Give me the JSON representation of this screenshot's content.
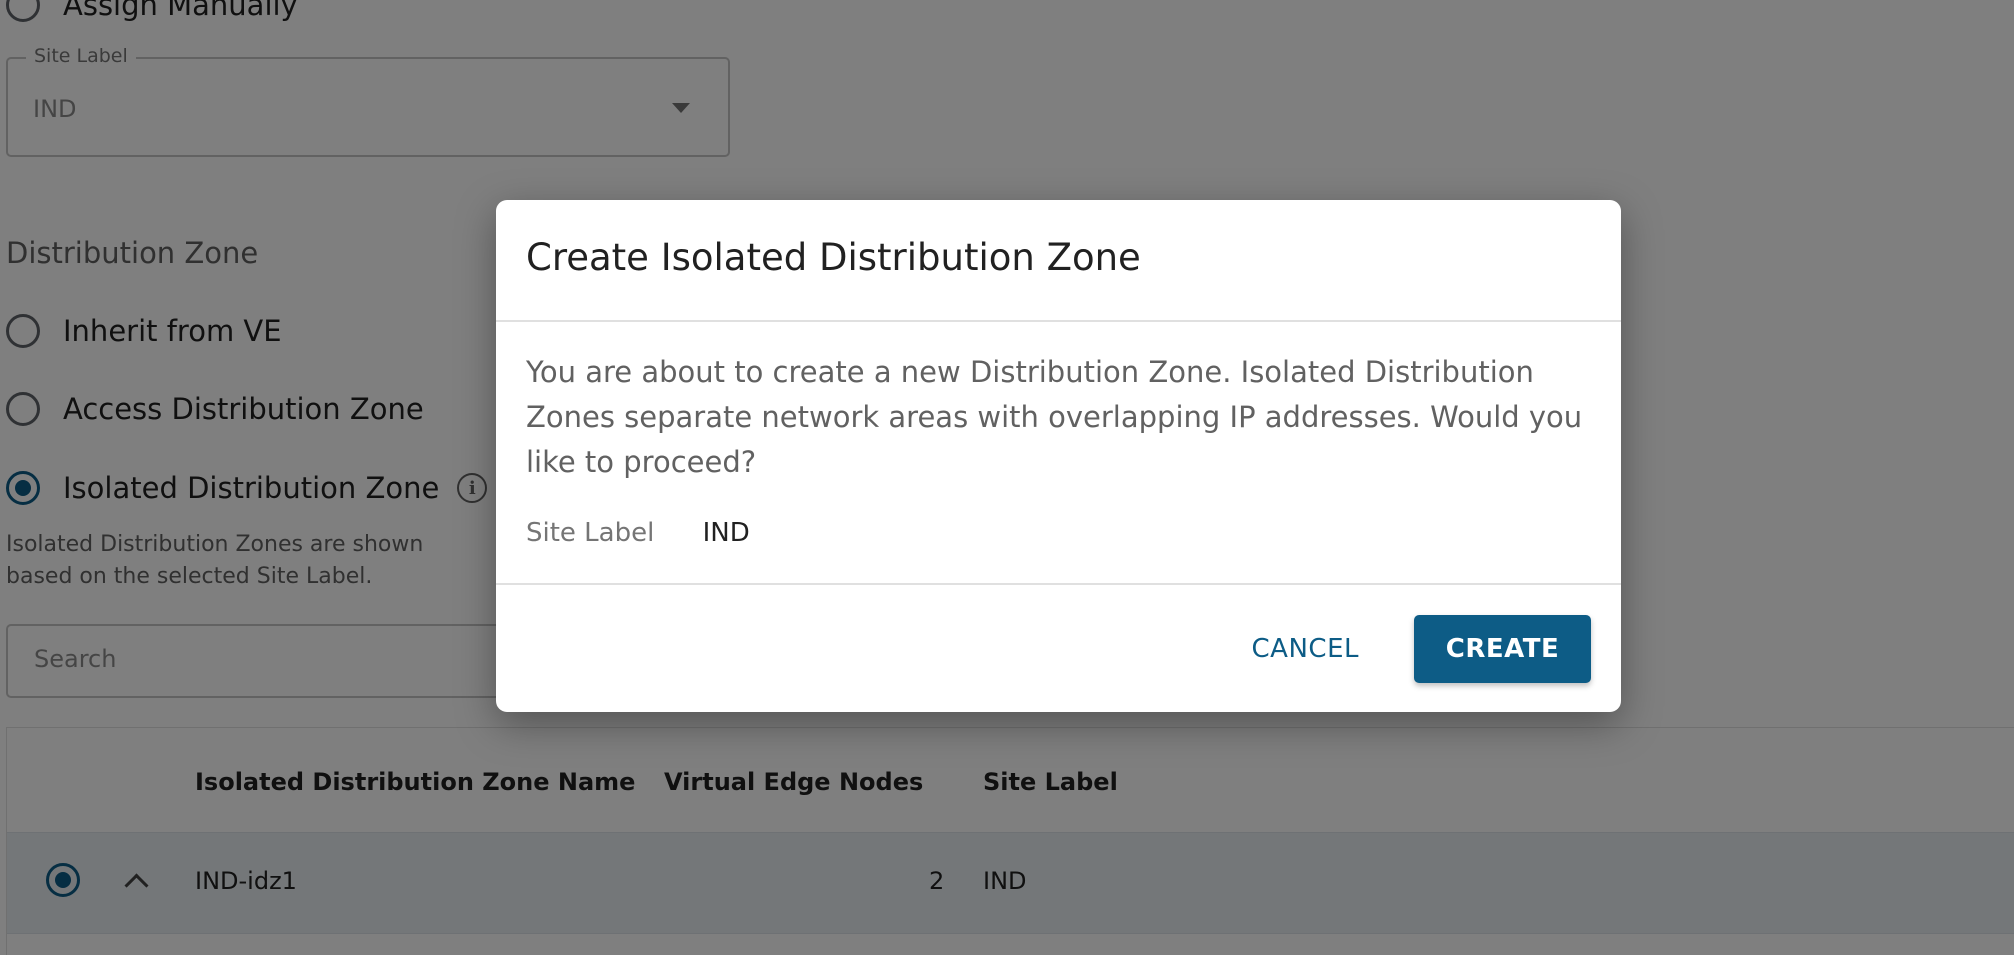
{
  "background": {
    "assign_manually_label": "Assign Manually",
    "site_label_field": {
      "label": "Site Label",
      "value": "IND"
    },
    "distribution_zone": {
      "heading": "Distribution Zone",
      "options": [
        {
          "label": "Inherit from VE",
          "selected": false
        },
        {
          "label": "Access Distribution Zone",
          "selected": false
        },
        {
          "label": "Isolated Distribution Zone",
          "selected": true
        }
      ],
      "helper_text": "Isolated Distribution Zones are shown based on the selected Site Label."
    },
    "search": {
      "placeholder": "Search"
    },
    "table": {
      "columns": [
        "Isolated Distribution Zone Name",
        "Virtual Edge Nodes",
        "Site Label"
      ],
      "rows": [
        {
          "name": "IND-idz1",
          "virtual_edge_nodes": "2",
          "site_label": "IND",
          "selected": true,
          "expanded": true
        }
      ]
    }
  },
  "dialog": {
    "title": "Create Isolated Distribution Zone",
    "message": "You are about to create a new Distribution Zone. Isolated Distribution Zones separate network areas with overlapping IP addresses. Would you like to proceed?",
    "site_label_key": "Site Label",
    "site_label_value": "IND",
    "cancel_label": "CANCEL",
    "create_label": "CREATE"
  },
  "colors": {
    "primary": "#0d5c86",
    "scrim": "rgba(0,0,0,0.5)",
    "row_selected_bg": "#e8eef2"
  }
}
